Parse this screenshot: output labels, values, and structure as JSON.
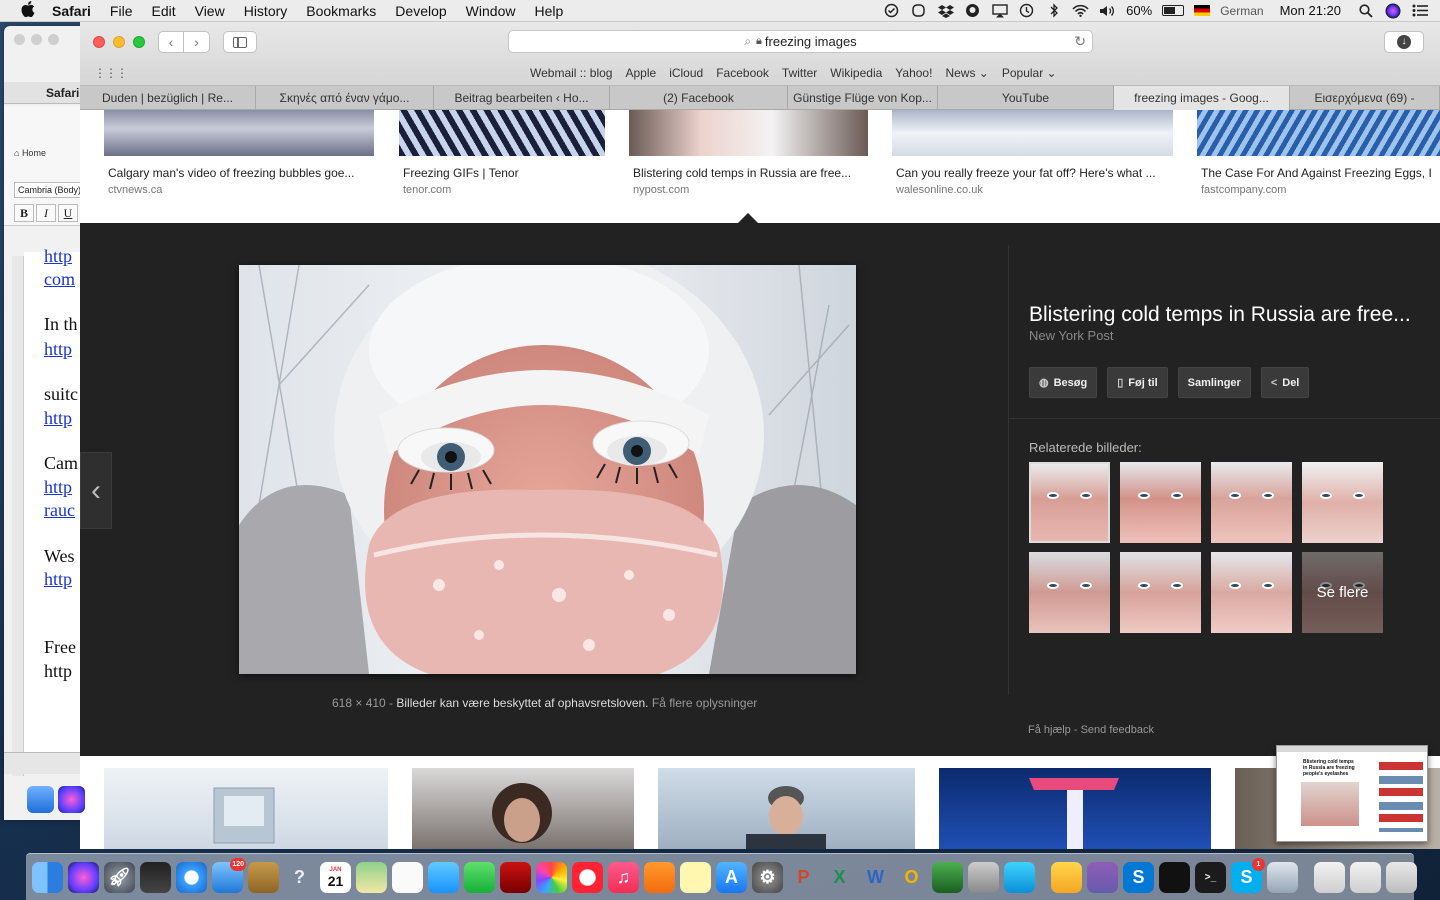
{
  "menubar": {
    "app": "Safari",
    "items": [
      "File",
      "Edit",
      "View",
      "History",
      "Bookmarks",
      "Develop",
      "Window",
      "Help"
    ],
    "battery_percent": "60%",
    "battery_level": 0.6,
    "input_source": "German",
    "clock": "Mon 21:20"
  },
  "word_window": {
    "app_label": "Safari",
    "home_label": "Home",
    "font_name": "Cambria (Body)",
    "format_buttons": [
      "B",
      "I",
      "U"
    ],
    "lines": [
      {
        "text": "http",
        "link": true
      },
      {
        "text": "com",
        "link": true
      },
      {
        "text": "In th",
        "link": false
      },
      {
        "text": "http",
        "link": true
      },
      {
        "text": "suitc",
        "link": false
      },
      {
        "text": "http",
        "link": true
      },
      {
        "text": "Cam",
        "link": false
      },
      {
        "text": "http",
        "link": true
      },
      {
        "text": "rauc",
        "link": true
      },
      {
        "text": "Wes",
        "link": false
      },
      {
        "text": "http",
        "link": true
      },
      {
        "text": "Free",
        "link": false
      },
      {
        "text": "http",
        "link": false
      }
    ]
  },
  "safari": {
    "address": "freezing  images",
    "favorites": [
      "Webmail :: blog",
      "Apple",
      "iCloud",
      "Facebook",
      "Twitter",
      "Wikipedia",
      "Yahoo!",
      "News ⌄",
      "Popular ⌄"
    ],
    "tabs": [
      {
        "label": "Duden | bezüglich | Re..."
      },
      {
        "label": "Σκηνές από έναν γάμο..."
      },
      {
        "label": "Beitrag bearbeiten ‹ Ho..."
      },
      {
        "label": "(2) Facebook"
      },
      {
        "label": "Günstige Flüge von Kop..."
      },
      {
        "label": "YouTube"
      },
      {
        "label": "freezing images - Goog...",
        "active": true
      },
      {
        "label": "Εισερχόμενα (69) -"
      }
    ]
  },
  "results_top": [
    {
      "title": "Calgary man's video of freezing bubbles goe...",
      "source": "ctvnews.ca"
    },
    {
      "title": "Freezing GIFs | Tenor",
      "source": "tenor.com"
    },
    {
      "title": "Blistering cold temps in Russia are free...",
      "source": "nypost.com"
    },
    {
      "title": "Can you really freeze your fat off? Here's what ...",
      "source": "walesonline.co.uk"
    },
    {
      "title": "The Case For And Against Freezing Eggs, I",
      "source": "fastcompany.com"
    }
  ],
  "detail": {
    "title": "Blistering cold temps in Russia are free...",
    "source": "New York Post",
    "actions": [
      {
        "label": "Besøg",
        "icon": "globe-icon"
      },
      {
        "label": "Føj til",
        "icon": "bookmark-icon"
      },
      {
        "label": "Samlinger",
        "icon": ""
      },
      {
        "label": "Del",
        "icon": "share-icon"
      }
    ],
    "related_label": "Relaterede billeder:",
    "see_more": "Se flere",
    "image_size": "618 × 410",
    "separator": " - ",
    "copyright": "Billeder kan være beskyttet af ophavsretsloven.",
    "more_info": "Få flere oplysninger",
    "help": "Få hjælp",
    "feedback": "Send feedback"
  },
  "preview": {
    "title": "Blistering cold temps in Russia are freezing people's eyelashes"
  },
  "dock": {
    "mail_badge": "120",
    "calendar_month": "JAN",
    "calendar_day": "21",
    "skype_badge": "1"
  }
}
